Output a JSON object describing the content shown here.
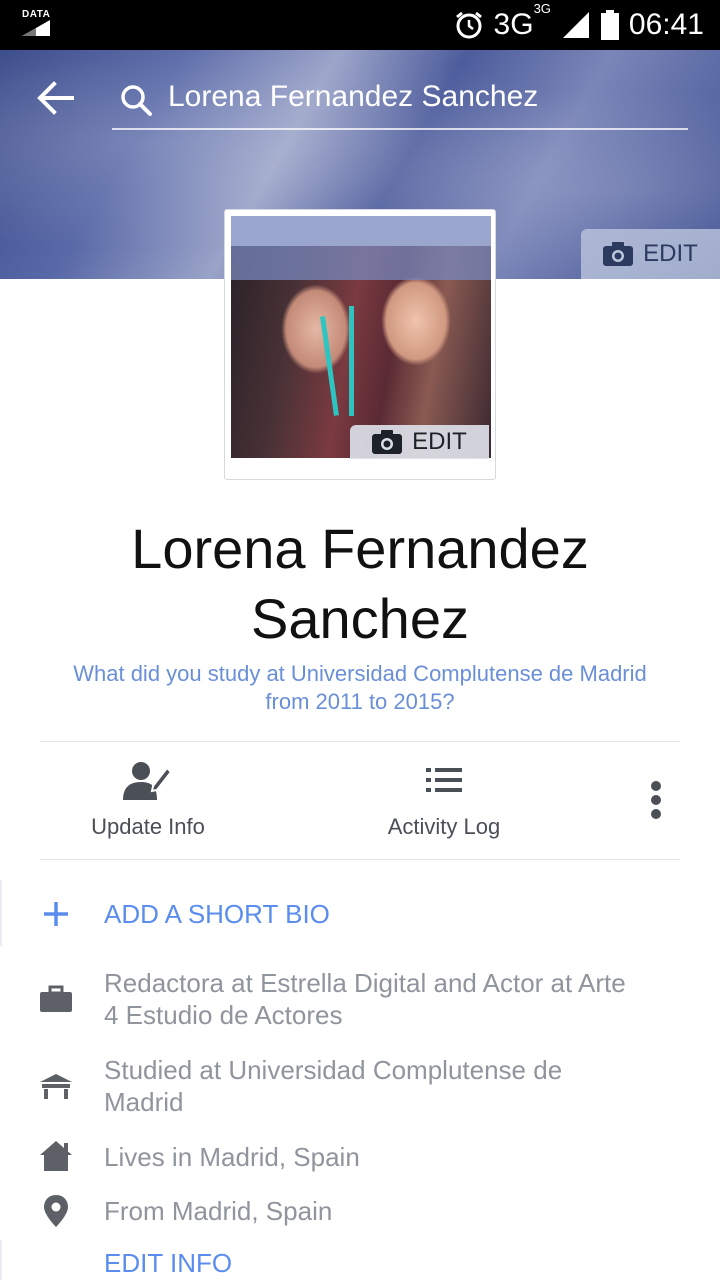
{
  "status_bar": {
    "data_label": "DATA",
    "network": "3G",
    "network_sup": "3G",
    "time": "06:41"
  },
  "header": {
    "search_value": "Lorena Fernandez Sanchez",
    "cover_edit_label": "EDIT",
    "profile_edit_label": "EDIT"
  },
  "profile": {
    "name_line1": "Lorena Fernandez",
    "name_line2": "Sanchez",
    "study_prompt_line1": "What did you study at Universidad Complutense de Madrid",
    "study_prompt_line2": "from 2011 to 2015?"
  },
  "actions": {
    "update_info": "Update Info",
    "activity_log": "Activity Log"
  },
  "about": {
    "add_bio": "ADD A SHORT BIO",
    "work_line1": "Redactora at Estrella Digital and Actor at Arte",
    "work_line2": "4 Estudio de Actores",
    "education_line1": "Studied at Universidad Complutense de",
    "education_line2": "Madrid",
    "lives": "Lives in Madrid, Spain",
    "from": "From Madrid, Spain",
    "edit_info": "EDIT INFO"
  },
  "colors": {
    "link_blue": "#5b8def",
    "secondary_text": "#90949c",
    "icon_gray": "#5d6067"
  }
}
